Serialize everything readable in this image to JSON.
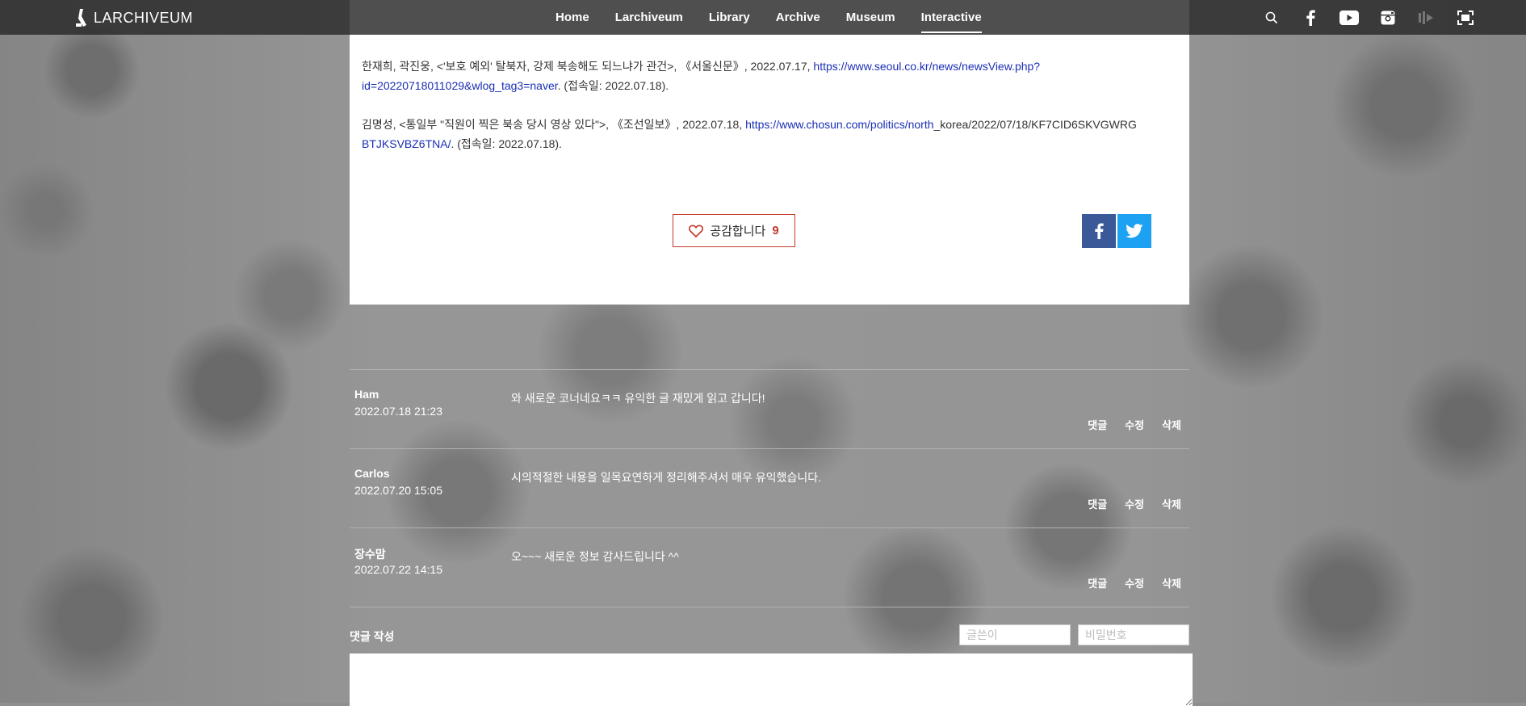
{
  "nav": {
    "logo_text": "LARCHIVEUM",
    "menu": [
      {
        "label": "Home"
      },
      {
        "label": "Larchiveum"
      },
      {
        "label": "Library"
      },
      {
        "label": "Archive"
      },
      {
        "label": "Museum"
      },
      {
        "label": "Interactive",
        "active": true
      }
    ],
    "icons": [
      "search-icon",
      "facebook-icon",
      "youtube-icon",
      "instagram-icon",
      "audio-icon",
      "fullscreen-icon"
    ]
  },
  "article": {
    "refs": [
      {
        "text_before": "한재희, 곽진웅, <'보호 예외' 탈북자, 강제 북송해도 되느냐가 관건>, 《서울신문》, 2022.07.17, ",
        "link": "https://www.seoul.co.kr/news/newsView.php?id=20220718011029&wlog_tag3=naver",
        "text_after": ". (접속일: 2022.07.18)."
      },
      {
        "text_before": "김명성, <통일부 \"직원이 찍은 북송 당시 영상 있다\">, 《조선일보》, 2022.07.18, ",
        "link": "https://www.chosun.com/politics/north",
        "text_mid": "_korea/2022/07/18/KF7CID6SKVGWRG",
        "link2": "BTJKSVBZ6TNA/",
        "text_after": ". (접속일: 2022.07.18)."
      }
    ],
    "like_label": "공감합니다",
    "like_count": "9"
  },
  "comments": [
    {
      "author": "Ham",
      "date": "2022.07.18 21:23",
      "text": "와 새로운 코너네요ㅋㅋ 유익한 글 재밌게 읽고 갑니다!"
    },
    {
      "author": "Carlos",
      "date": "2022.07.20 15:05",
      "text": "시의적절한 내용을 일목요연하게 정리해주셔서 매우 유익했습니다."
    },
    {
      "author": "장수맘",
      "date": "2022.07.22 14:15",
      "text": "오~~~ 새로운 정보 감사드립니다 ^^"
    }
  ],
  "comment_actions": {
    "reply": "댓글",
    "edit": "수정",
    "delete": "삭제"
  },
  "write": {
    "label": "댓글 작성",
    "writer_placeholder": "글쓴이",
    "password_placeholder": "비밀번호"
  }
}
